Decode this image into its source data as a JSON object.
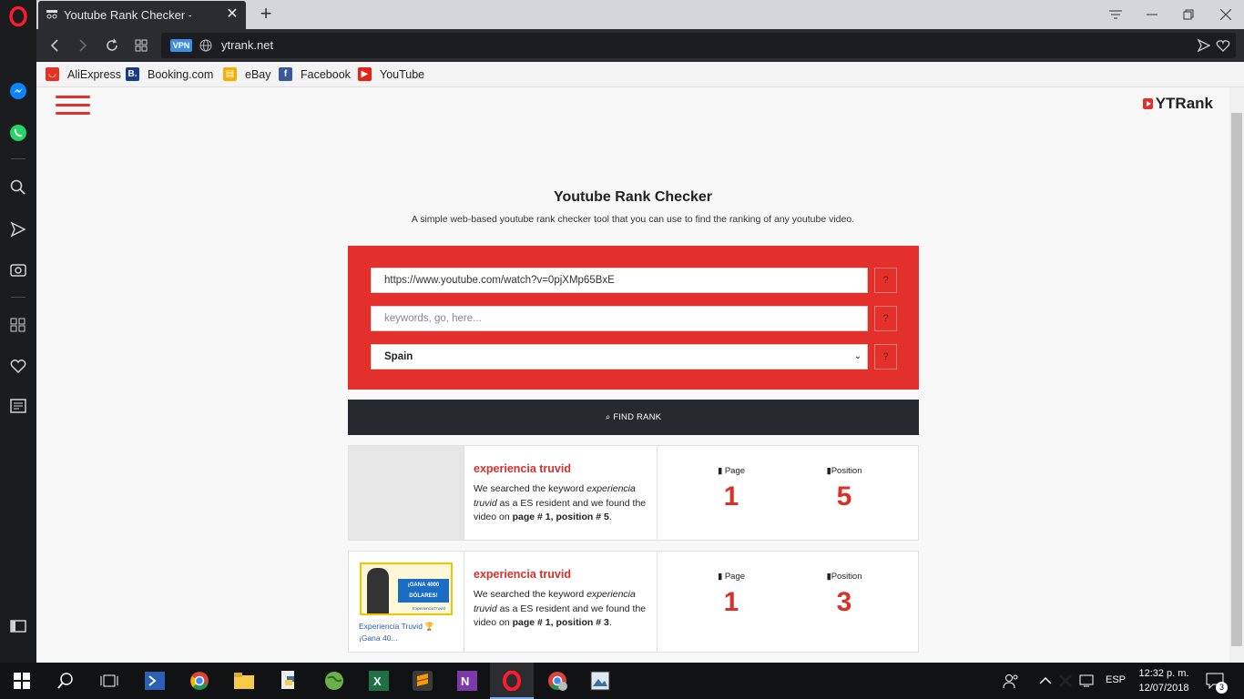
{
  "browser": {
    "tab_title": "Youtube Rank Checker - Fr",
    "url": "ytrank.net",
    "vpn_label": "VPN",
    "bookmarks": [
      {
        "label": "AliExpress",
        "color": "#e43226"
      },
      {
        "label": "Booking.com",
        "color": "#1a3a85",
        "glyph": "B."
      },
      {
        "label": "eBay",
        "color": "#f5af02"
      },
      {
        "label": "Facebook",
        "color": "#3b5998",
        "glyph": "f"
      },
      {
        "label": "YouTube",
        "color": "#e62117"
      }
    ]
  },
  "site": {
    "logo": "YTRank",
    "headline": "Youtube Rank Checker",
    "subline": "A simple web-based youtube rank checker tool that you can use to find the ranking of any youtube video.",
    "form": {
      "video_url_value": "https://www.youtube.com/watch?v=0pjXMp65BxE",
      "keywords_placeholder": "keywords, go, here...",
      "country_selected": "Spain",
      "help_label": "?"
    },
    "find_button": "FIND RANK",
    "results": [
      {
        "title": "experiencia truvid",
        "text_pre": "We searched the keyword ",
        "keyword": "experiencia truvid",
        "text_mid": " as a ES resident and we found the video on ",
        "page_pos": "page # 1, position # 5",
        "text_end": ".",
        "page_label": "Page",
        "position_label": "Position",
        "page": "1",
        "position": "5",
        "thumb_caption": ""
      },
      {
        "title": "experiencia truvid",
        "text_pre": "We searched the keyword ",
        "keyword": "experiencia truvid",
        "text_mid": " as a ES resident and we found the video on ",
        "page_pos": "page # 1, position # 3",
        "text_end": ".",
        "page_label": "Page",
        "position_label": "Position",
        "page": "1",
        "position": "3",
        "thumb_caption": "Experiencia Truvid 🏆 ¡Gana 40...",
        "thumb_ad_text": "¡GANA 4000 DÓLARES!",
        "thumb_small_text": "ExperienciaTruvid"
      }
    ]
  },
  "taskbar": {
    "language": "ESP",
    "time": "12:32 p. m.",
    "date": "12/07/2018",
    "notifications": "3"
  }
}
